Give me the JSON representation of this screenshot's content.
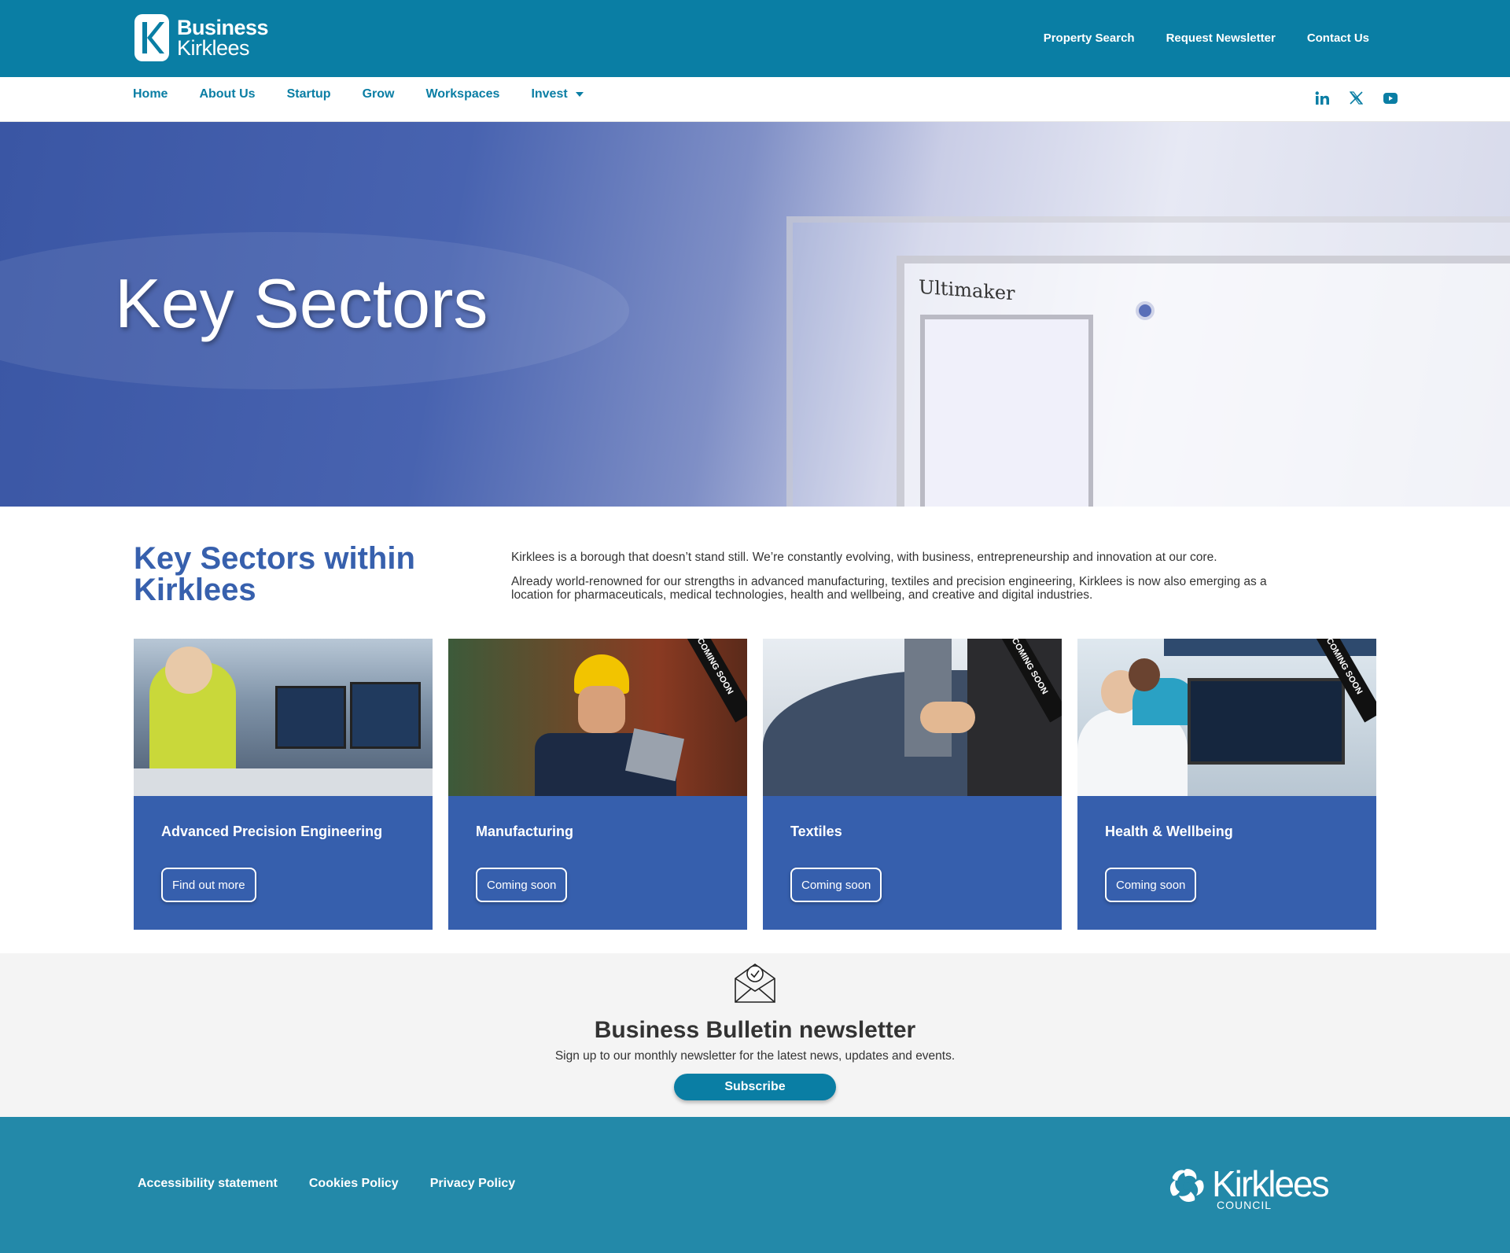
{
  "header": {
    "logo_line1": "Business",
    "logo_line2": "Kirklees",
    "top_links": [
      "Property Search",
      "Request Newsletter",
      "Contact Us"
    ]
  },
  "nav": {
    "items": [
      "Home",
      "About Us",
      "Startup",
      "Grow",
      "Workspaces",
      "Invest"
    ],
    "social": [
      "linkedin-icon",
      "x-icon",
      "youtube-icon"
    ]
  },
  "hero": {
    "title": "Key Sectors",
    "image_brand_text": "Ultimaker"
  },
  "intro": {
    "title": "Key Sectors within Kirklees",
    "paragraphs": [
      "Kirklees is a borough that doesn’t stand still. We’re constantly evolving, with business, entrepreneurship and innovation at our core.",
      "Already world-renowned for our strengths in advanced manufacturing, textiles and precision engineering, Kirklees is now also emerging as a location for pharmaceuticals, medical technologies, health and wellbeing, and creative and digital industries."
    ]
  },
  "cards": [
    {
      "title": "Advanced Precision Engineering",
      "button": "Find out more",
      "ribbon": ""
    },
    {
      "title": "Manufacturing",
      "button": "Coming soon",
      "ribbon": "COMING SOON"
    },
    {
      "title": "Textiles",
      "button": "Coming soon",
      "ribbon": "COMING SOON"
    },
    {
      "title": "Health & Wellbeing",
      "button": "Coming soon",
      "ribbon": "COMING SOON"
    }
  ],
  "newsletter": {
    "title": "Business Bulletin newsletter",
    "text": "Sign up to our monthly newsletter for the latest news, updates and events.",
    "button": "Subscribe"
  },
  "footer": {
    "links": [
      "Accessibility statement",
      "Cookies Policy",
      "Privacy Policy"
    ],
    "logo_name": "Kirklees",
    "logo_sub": "COUNCIL"
  },
  "colors": {
    "brand_teal": "#0a7ea4",
    "card_blue": "#365fad",
    "heading_blue": "#3760ad",
    "footer_teal": "#2389a9"
  }
}
